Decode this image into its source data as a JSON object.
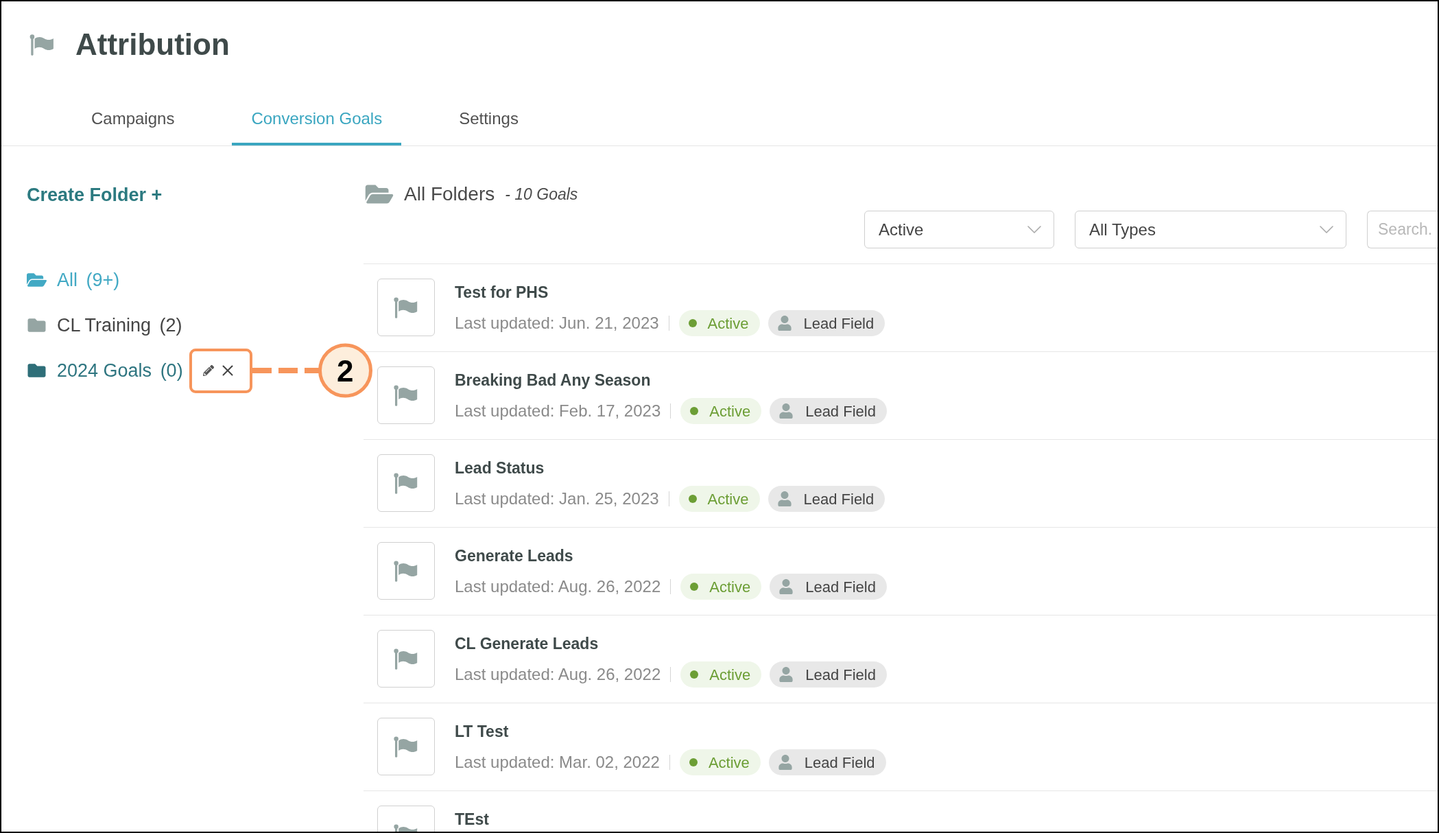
{
  "header": {
    "title": "Attribution"
  },
  "tabs": [
    {
      "label": "Campaigns",
      "selected": false
    },
    {
      "label": "Conversion Goals",
      "selected": true
    },
    {
      "label": "Settings",
      "selected": false
    }
  ],
  "sidebar": {
    "create_folder": "Create Folder +",
    "folders": [
      {
        "name": "All",
        "count": "(9+)",
        "selected": true,
        "hovered": false
      },
      {
        "name": "CL Training",
        "count": "(2)",
        "selected": false,
        "hovered": false
      },
      {
        "name": "2024 Goals",
        "count": "(0)",
        "selected": false,
        "hovered": true,
        "callout": "2"
      }
    ]
  },
  "list": {
    "title": "All Folders",
    "count": "- 10 Goals",
    "filters": [
      {
        "value": "Active"
      },
      {
        "value": "All Types"
      }
    ],
    "search": {
      "placeholder": "Search."
    },
    "goals": [
      {
        "name": "Test for PHS",
        "updated": "Last updated: Jun. 21, 2023",
        "status": "Active",
        "type": "Lead Field"
      },
      {
        "name": "Breaking Bad Any Season",
        "updated": "Last updated: Feb. 17, 2023",
        "status": "Active",
        "type": "Lead Field"
      },
      {
        "name": "Lead Status",
        "updated": "Last updated: Jan. 25, 2023",
        "status": "Active",
        "type": "Lead Field"
      },
      {
        "name": "Generate Leads",
        "updated": "Last updated: Aug. 26, 2022",
        "status": "Active",
        "type": "Lead Field"
      },
      {
        "name": "CL Generate Leads",
        "updated": "Last updated: Aug. 26, 2022",
        "status": "Active",
        "type": "Lead Field"
      },
      {
        "name": "LT Test",
        "updated": "Last updated: Mar. 02, 2022",
        "status": "Active",
        "type": "Lead Field"
      },
      {
        "name": "TEst"
      }
    ]
  }
}
